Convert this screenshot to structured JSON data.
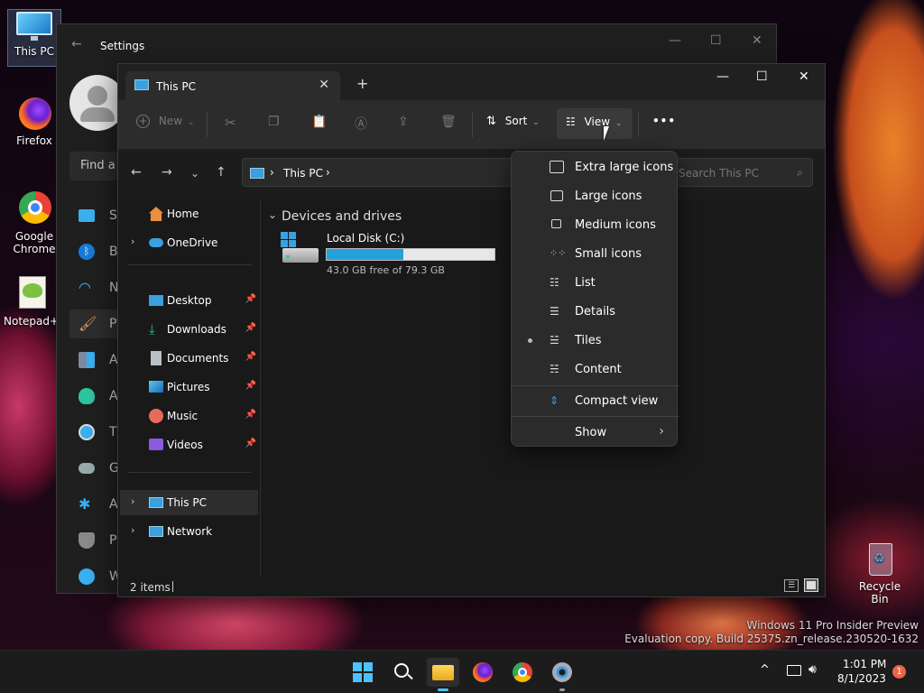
{
  "desktop": {
    "icons": [
      {
        "label": "This PC"
      },
      {
        "label": "Firefox"
      },
      {
        "label": "Google Chrome"
      },
      {
        "label": "Notepad++"
      },
      {
        "label": "Recycle Bin"
      }
    ],
    "watermark_line1": "Windows 11 Pro Insider Preview",
    "watermark_line2": "Evaluation copy. Build 25375.zn_release.230520-1632"
  },
  "settings": {
    "title": "Settings",
    "search_placeholder": "Find a",
    "nav": [
      {
        "label": "Sy"
      },
      {
        "label": "B"
      },
      {
        "label": "N"
      },
      {
        "label": "P"
      },
      {
        "label": "A"
      },
      {
        "label": "A"
      },
      {
        "label": "T"
      },
      {
        "label": "G"
      },
      {
        "label": "A"
      },
      {
        "label": "P"
      },
      {
        "label": "W"
      }
    ]
  },
  "explorer": {
    "tab_title": "This PC",
    "toolbar": {
      "new_label": "New",
      "sort_label": "Sort",
      "view_label": "View",
      "more_label": "•••"
    },
    "address": {
      "location": "This PC"
    },
    "search": {
      "placeholder": "Search This PC"
    },
    "sidebar": {
      "home": "Home",
      "onedrive": "OneDrive",
      "quick": [
        {
          "label": "Desktop"
        },
        {
          "label": "Downloads"
        },
        {
          "label": "Documents"
        },
        {
          "label": "Pictures"
        },
        {
          "label": "Music"
        },
        {
          "label": "Videos"
        }
      ],
      "this_pc": "This PC",
      "network": "Network"
    },
    "content": {
      "group_title": "Devices and drives",
      "drive_name": "Local Disk (C:)",
      "drive_free": "43.0 GB free of 79.3 GB",
      "drive_used_fraction": 0.458
    },
    "status": {
      "items": "2 items"
    }
  },
  "view_menu": {
    "items": [
      {
        "label": "Extra large icons",
        "selected": false
      },
      {
        "label": "Large icons",
        "selected": false
      },
      {
        "label": "Medium icons",
        "selected": false
      },
      {
        "label": "Small icons",
        "selected": false
      },
      {
        "label": "List",
        "selected": false
      },
      {
        "label": "Details",
        "selected": false
      },
      {
        "label": "Tiles",
        "selected": true
      },
      {
        "label": "Content",
        "selected": false
      }
    ],
    "compact": "Compact view",
    "show": "Show"
  },
  "taskbar": {
    "time": "1:01 PM",
    "date": "8/1/2023",
    "notification_count": "1"
  },
  "colors": {
    "accent": "#3aa0e0",
    "taskbar_bg": "#1c1c1c",
    "badge": "#e8654a"
  }
}
